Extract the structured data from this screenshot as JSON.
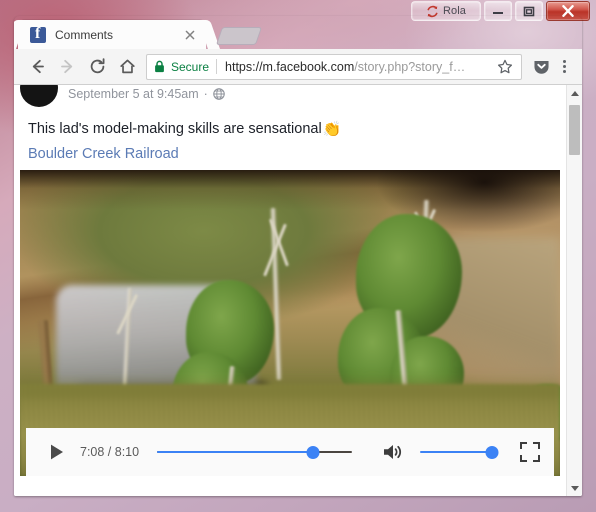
{
  "window": {
    "rola_button_label": "Rola",
    "rola_icon": "sync-refresh-icon",
    "minimize_label": "–",
    "maximize_label": "□",
    "close_label": "✕"
  },
  "browser": {
    "tab": {
      "title": "Comments",
      "favicon": "facebook-f-icon",
      "close_label": "✕"
    },
    "new_tab_label": "",
    "toolbar": {
      "back_icon": "arrow-left-icon",
      "forward_icon": "arrow-right-icon",
      "reload_icon": "reload-icon",
      "home_icon": "home-icon",
      "bookmark_icon": "star-icon",
      "extension_icon": "pocket-icon",
      "menu_icon": "three-dots-menu-icon"
    },
    "omnibox": {
      "lock_icon": "padlock-icon",
      "security_label": "Secure",
      "url_host": "https://m.facebook.com",
      "url_path": "/story.php?story_f…",
      "url_full": "https://m.facebook.com/story.php?story_f…"
    }
  },
  "post": {
    "avatar": "profile-avatar",
    "timestamp": "September 5 at 9:45am",
    "meta_separator": "·",
    "privacy_icon": "globe-public-icon",
    "body_text": "This lad's model-making skills are sensational",
    "body_emoji": "👏",
    "link_text": "Boulder Creek Railroad"
  },
  "video": {
    "alt": "Blurred model railroad diorama with miniature trees, rock cliff and dry grass",
    "play_icon": "play-triangle-icon",
    "current_time": "7:08",
    "total_time": "8:10",
    "time_display": "7:08 / 8:10",
    "progress_percent": 80,
    "volume_icon": "speaker-volume-icon",
    "volume_percent": 92,
    "fullscreen_icon": "fullscreen-expand-icon"
  },
  "scrollbar": {
    "up_icon": "scroll-up-arrow-icon",
    "down_icon": "scroll-down-arrow-icon"
  },
  "colors": {
    "accent_blue": "#3b82f5",
    "secure_green": "#0b8043",
    "facebook_blue": "#3b5998",
    "link_blue": "#5b7bb5",
    "meta_gray": "#90949c",
    "aero_frame": "#c9aec4"
  }
}
